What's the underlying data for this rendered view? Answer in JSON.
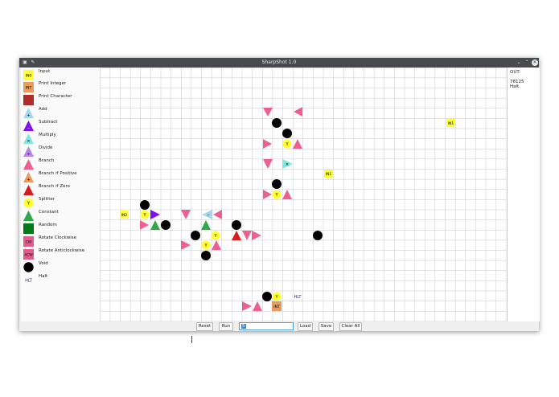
{
  "window": {
    "title": "SharpShot 1.0"
  },
  "tools": [
    {
      "label": "Input",
      "icon": "input-icon"
    },
    {
      "label": "Print Integer",
      "icon": "print-integer-icon"
    },
    {
      "label": "Print Character",
      "icon": "print-character-icon"
    },
    {
      "label": "Add",
      "icon": "add-icon"
    },
    {
      "label": "Subtract",
      "icon": "subtract-icon"
    },
    {
      "label": "Multiply",
      "icon": "multiply-icon"
    },
    {
      "label": "Divide",
      "icon": "divide-icon"
    },
    {
      "label": "Branch",
      "icon": "branch-icon"
    },
    {
      "label": "Branch if Positive",
      "icon": "branch-if-positive-icon"
    },
    {
      "label": "Branch if Zero",
      "icon": "branch-if-zero-icon"
    },
    {
      "label": "Splitter",
      "icon": "splitter-icon"
    },
    {
      "label": "Constant",
      "icon": "constant-icon"
    },
    {
      "label": "Random",
      "icon": "random-icon"
    },
    {
      "label": "Rotate Clockwise",
      "icon": "rotate-clockwise-icon"
    },
    {
      "label": "Rotate Anticlockwise",
      "icon": "rotate-anticlockwise-icon"
    },
    {
      "label": "Void",
      "icon": "void-icon"
    },
    {
      "label": "Halt",
      "icon": "halt-icon"
    }
  ],
  "tool_icon_text": {
    "input": "IN0",
    "print_integer": "INT",
    "splitter": "Y",
    "rotate_cw": "CW",
    "rotate_ccw": "ACW",
    "halt": "HLT",
    "add": "+",
    "subtract": "−",
    "multiply": "×",
    "divide": "÷",
    "branch_pos": "+"
  },
  "grid_labels": {
    "in1_top": "IN1",
    "in1_mid": "IN1",
    "in2": "IN2",
    "halt": "HLT",
    "int": "INT",
    "y": "Y",
    "mult": "×",
    "minus": "−"
  },
  "output": {
    "label": "OUT:",
    "lines": [
      "78125",
      "Halt."
    ]
  },
  "buttons": {
    "reset": "Reset",
    "run": "Run",
    "load": "Load",
    "save": "Save",
    "clear_all": "Clear All"
  },
  "input_field": {
    "value": "5"
  },
  "colors": {
    "pink": "#ee5f8f",
    "yellow": "#ffff33",
    "black": "#000000",
    "purple": "#7e12e8",
    "green": "#2fa84a",
    "red": "#d91c1c",
    "cyan": "#7fe8df",
    "orange": "#e79b5f",
    "brown": "#b22b2b",
    "lightblue": "#a9d6ef",
    "lavender": "#b882e6",
    "darkgreen": "#007a16",
    "ccw": "#e05b8e"
  }
}
